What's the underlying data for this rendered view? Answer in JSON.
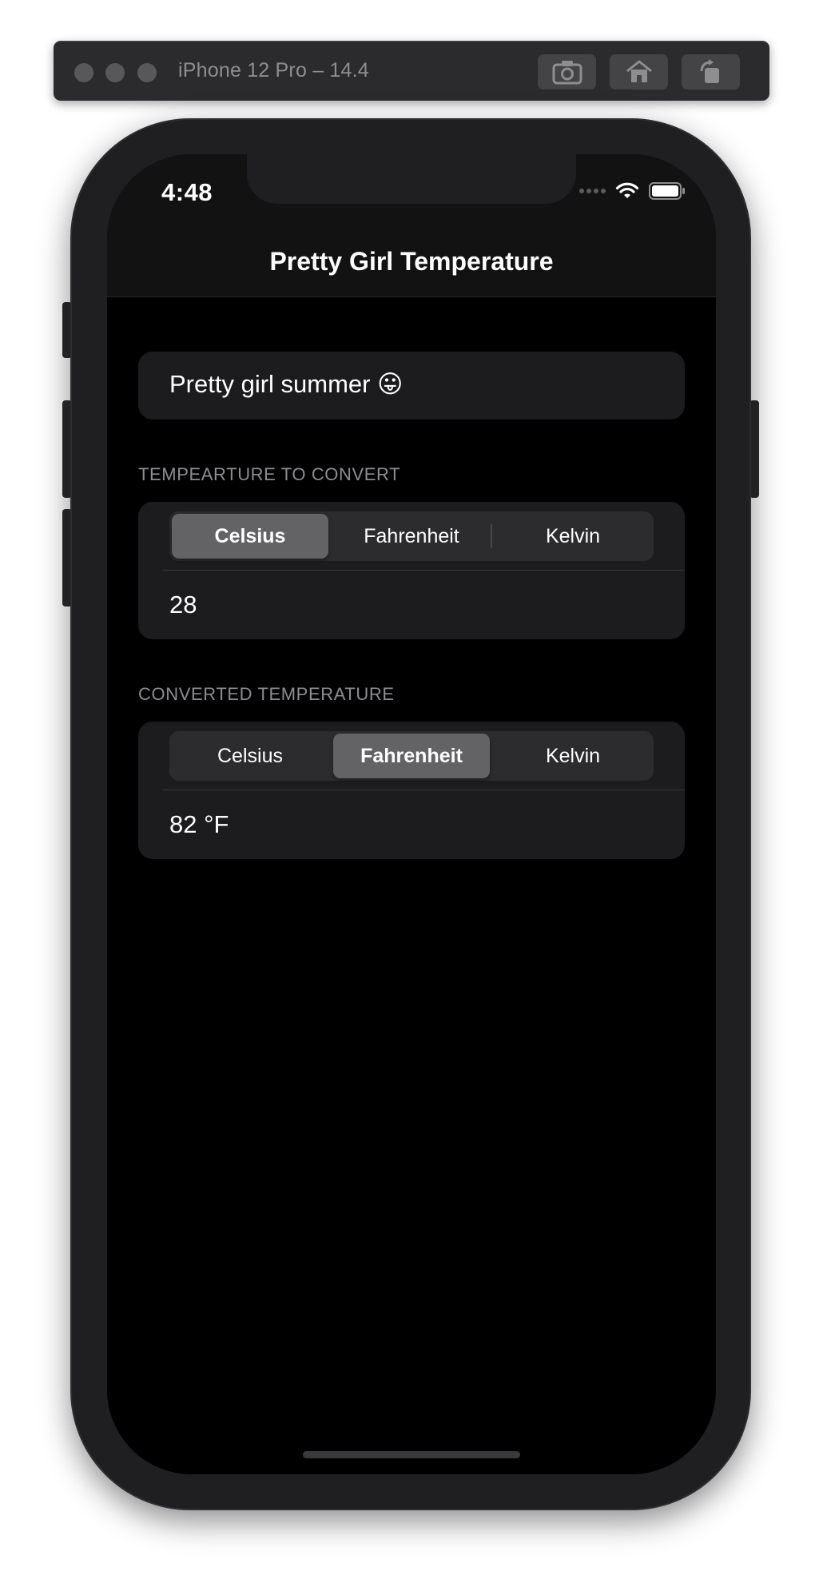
{
  "simulator": {
    "device_title": "iPhone 12 Pro – 14.4",
    "toolbar_icons": [
      "screenshot-icon",
      "home-icon",
      "rotate-icon"
    ]
  },
  "status_bar": {
    "time": "4:48",
    "icons": [
      "cellular-dots-icon",
      "wifi-icon",
      "battery-icon"
    ]
  },
  "nav": {
    "title": "Pretty Girl Temperature"
  },
  "form": {
    "name_field": {
      "value": "Pretty girl summer 😛"
    },
    "input_section": {
      "header": "TEMPEARTURE TO CONVERT",
      "units": [
        "Celsius",
        "Fahrenheit",
        "Kelvin"
      ],
      "selected_unit": "Celsius",
      "value": "28"
    },
    "output_section": {
      "header": "CONVERTED TEMPERATURE",
      "units": [
        "Celsius",
        "Fahrenheit",
        "Kelvin"
      ],
      "selected_unit": "Fahrenheit",
      "value": "82 °F"
    }
  },
  "colors": {
    "background": "#000000",
    "cell": "#1c1c1e",
    "segment_track": "#2c2c2e",
    "segment_selected": "#636366",
    "section_header": "#8d8d92"
  }
}
